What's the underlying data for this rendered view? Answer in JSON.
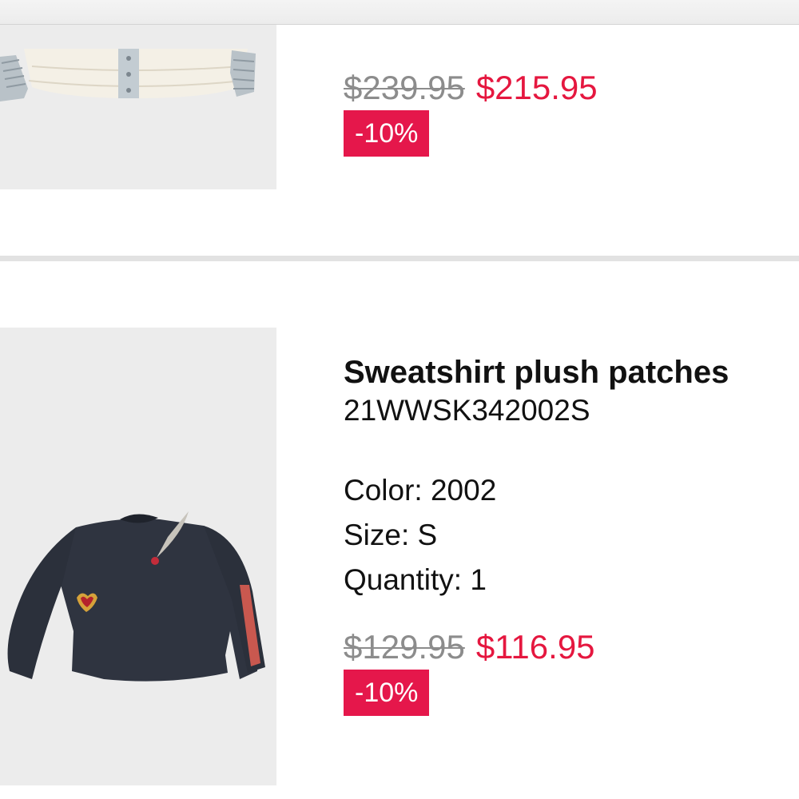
{
  "products": [
    {
      "image_alt": "cream puffer jacket with grey knit trim",
      "price_original": "$239.95",
      "price_sale": "$215.95",
      "discount": "-10%"
    },
    {
      "image_alt": "navy cropped sweatshirt with sequin patches",
      "name": "Sweatshirt plush patches",
      "sku": "21WWSK342002S",
      "color_label": "Color: 2002",
      "size_label": "Size: S",
      "quantity_label": "Quantity: 1",
      "price_original": "$129.95",
      "price_sale": "$116.95",
      "discount": "-10%"
    }
  ],
  "colors": {
    "sale_price": "#e5173f",
    "badge_background": "#e5174b",
    "old_price": "#8c8c8c",
    "divider": "#e2e2e2",
    "thumb_background": "#ececec"
  }
}
